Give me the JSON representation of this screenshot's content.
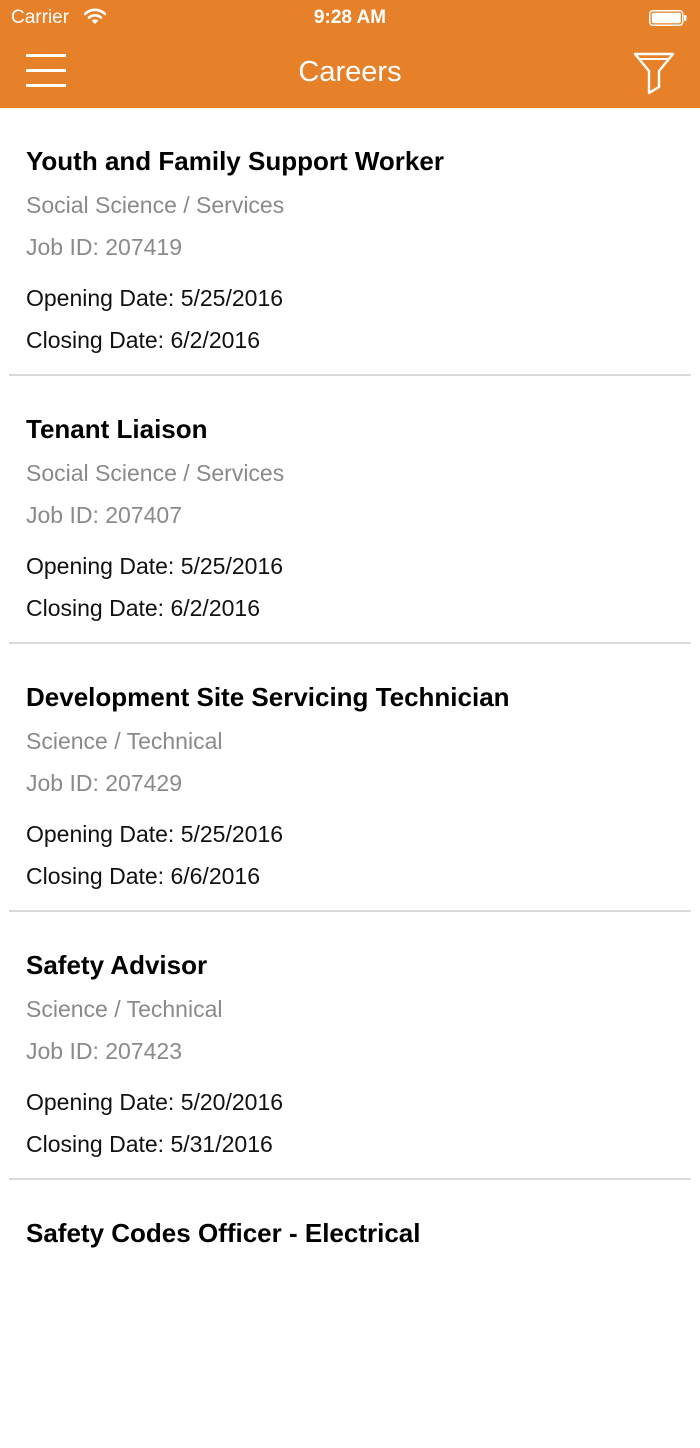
{
  "status_bar": {
    "carrier": "Carrier",
    "time": "9:28 AM",
    "wifi_icon": "wifi-icon",
    "battery_icon": "battery-icon"
  },
  "nav": {
    "title": "Careers",
    "menu_icon": "hamburger-menu-icon",
    "filter_icon": "filter-funnel-icon",
    "color": "#e6812a"
  },
  "jobs": [
    {
      "title": "Youth and Family Support Worker",
      "category": "Social Science / Services",
      "job_id": "Job ID: 207419",
      "opening": "Opening Date: 5/25/2016",
      "closing": "Closing Date: 6/2/2016"
    },
    {
      "title": "Tenant Liaison",
      "category": "Social Science / Services",
      "job_id": "Job ID: 207407",
      "opening": "Opening Date: 5/25/2016",
      "closing": "Closing Date: 6/2/2016"
    },
    {
      "title": "Development Site Servicing Technician",
      "category": "Science / Technical",
      "job_id": "Job ID: 207429",
      "opening": "Opening Date: 5/25/2016",
      "closing": "Closing Date: 6/6/2016"
    },
    {
      "title": "Safety Advisor",
      "category": "Science / Technical",
      "job_id": "Job ID: 207423",
      "opening": "Opening Date: 5/20/2016",
      "closing": "Closing Date: 5/31/2016"
    },
    {
      "title": "Safety Codes Officer - Electrical"
    }
  ]
}
